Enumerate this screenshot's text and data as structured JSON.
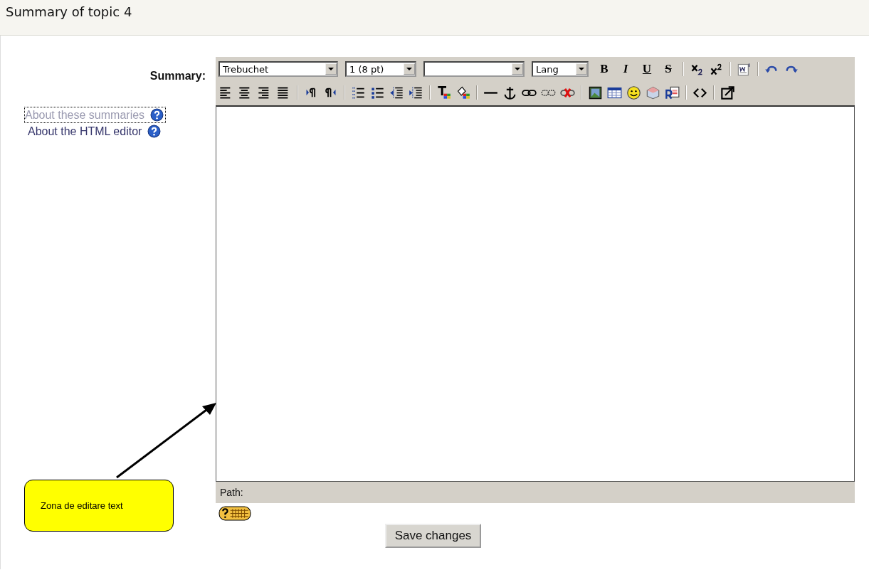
{
  "page_title": "Summary of topic 4",
  "field_label": "Summary:",
  "help_links": [
    {
      "label": "About these summaries",
      "focused": true
    },
    {
      "label": "About the HTML editor",
      "focused": false
    }
  ],
  "editor": {
    "selects": [
      {
        "value": "Trebuchet",
        "kind": "font"
      },
      {
        "value": "1 (8 pt)",
        "kind": "size"
      },
      {
        "kind": "format"
      },
      {
        "value": "Lang",
        "kind": "lang"
      }
    ],
    "format_buttons": [
      {
        "label": "B",
        "kind": "bold"
      },
      {
        "label": "I",
        "kind": "italic"
      },
      {
        "label": "U",
        "kind": "underline"
      },
      {
        "label": "S",
        "kind": "strike"
      }
    ],
    "path_label": "Path:"
  },
  "callout": {
    "text": "Zona de editare text"
  },
  "save_button": "Save changes"
}
